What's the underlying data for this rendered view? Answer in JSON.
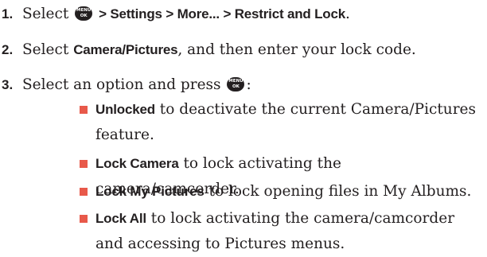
{
  "menu_key": {
    "top": "MENU",
    "bottom": "OK"
  },
  "steps": [
    {
      "number": "1.",
      "select": "Select",
      "path": "> Settings > More... > Restrict and Lock",
      "end": "."
    },
    {
      "number": "2.",
      "select": "Select",
      "item": "Camera/Pictures",
      "rest": ", and then enter your lock code."
    },
    {
      "number": "3.",
      "text": "Select an option and press",
      "end": ":"
    }
  ],
  "options": [
    {
      "label": "Unlocked",
      "description": " to deactivate the current Camera/Pictures feature."
    },
    {
      "label": "Lock Camera",
      "description": " to lock activating the camera/camcorder."
    },
    {
      "label": "Lock My Pictures",
      "description": " to lock opening files in My Albums."
    },
    {
      "label": "Lock All",
      "description": " to lock activating the camera/camcorder and accessing to Pictures menus."
    }
  ]
}
